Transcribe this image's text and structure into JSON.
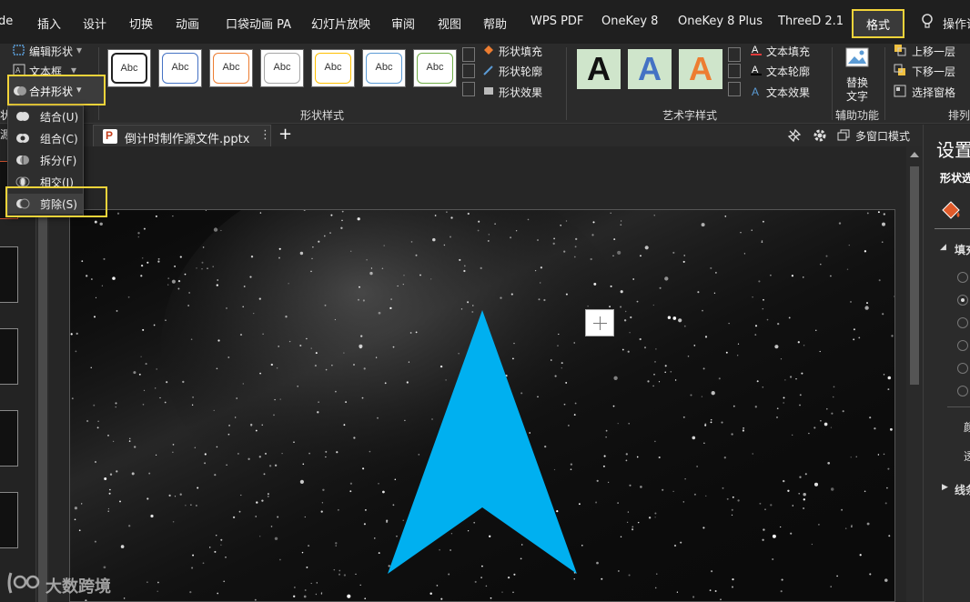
{
  "menubar": {
    "tabs": [
      "de",
      "插入",
      "设计",
      "切换",
      "动画",
      "口袋动画 PA",
      "幻灯片放映",
      "审阅",
      "视图",
      "帮助",
      "WPS PDF",
      "OneKey 8",
      "OneKey 8 Plus",
      "ThreeD 2.1"
    ],
    "active_tab": "格式",
    "tell_me": "操作说"
  },
  "ribbon": {
    "insert_shapes": {
      "edit_shape": "编辑形状",
      "text_box": "文本框",
      "merge_shapes": "合并形状",
      "group_label_fragment": "状"
    },
    "shape_styles": {
      "label": "形状样式",
      "thumb_text": "Abc",
      "thumb_colors": [
        "#222222",
        "#4472c4",
        "#ed7d31",
        "#a5a5a5",
        "#ffc000",
        "#5b9bd5",
        "#70ad47"
      ],
      "fill": "形状填充",
      "outline": "形状轮廓",
      "effects": "形状效果"
    },
    "wordart_styles": {
      "label": "艺术字样式",
      "letters": [
        "A",
        "A",
        "A"
      ],
      "letter_colors": [
        "#111111",
        "#4472c4",
        "#ed7d31"
      ],
      "text_fill": "文本填充",
      "text_outline": "文本轮廓",
      "text_effects": "文本效果"
    },
    "accessibility": {
      "label": "辅助功能",
      "alt_text_line1": "替换",
      "alt_text_line2": "文字"
    },
    "arrange": {
      "label": "排列",
      "bring_forward": "上移一层",
      "send_backward": "下移一层",
      "selection_pane": "选择窗格"
    }
  },
  "merge_menu": {
    "items": [
      "结合(U)",
      "组合(C)",
      "拆分(F)",
      "相交(I)",
      "剪除(S)"
    ],
    "highlighted": "剪除(S)"
  },
  "left_panel": {
    "label_fragment": "源"
  },
  "document": {
    "tab_title": "倒计时制作源文件.pptx",
    "multi_window": "多窗口模式"
  },
  "slide": {
    "shape": "arrow",
    "shape_color": "#00b0f0",
    "background": "starry night"
  },
  "format_pane": {
    "title": "设置",
    "subtitle": "形状选",
    "section_fill": "填充",
    "label_color": "颜",
    "label_transparency": "透",
    "section_line": "线条"
  },
  "watermark": {
    "text": "大数跨境"
  },
  "colors": {
    "highlight": "#f2d43a",
    "accent": "#00b0f0"
  }
}
